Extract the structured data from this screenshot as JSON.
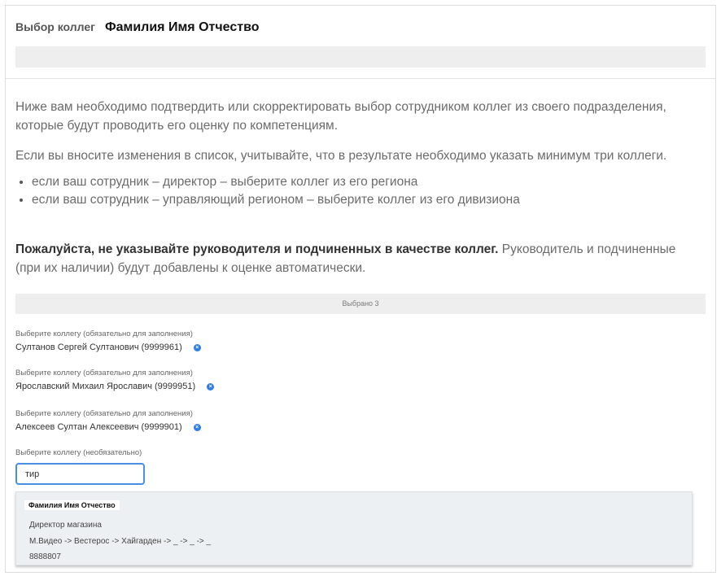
{
  "header": {
    "label": "Выбор коллег",
    "name": "Фамилия Имя Отчество"
  },
  "intro": {
    "p1": "Ниже вам необходимо подтвердить или скорректировать выбор сотрудником коллег из своего подразделения, которые будут проводить его оценку по компетенциям.",
    "p2": "Если вы вносите изменения в список, учитывайте, что в результате необходимо указать минимум три коллеги.",
    "bullets": [
      "если ваш сотрудник – директор – выберите коллег из его региона",
      "если ваш сотрудник – управляющий регионом – выберите коллег из его дивизиона"
    ],
    "p3_bold": "Пожалуйста, не указывайте руководителя и подчиненных в качестве коллег.",
    "p3_rest": " Руководитель и подчиненные (при их наличии) будут добавлены к оценке автоматически."
  },
  "selected_bar": "Выбрано 3",
  "fields": [
    {
      "label": "Выберите коллегу (обязательно для заполнения)",
      "value": "Султанов Сергей Султанович (9999961)"
    },
    {
      "label": "Выберите коллегу (обязательно для заполнения)",
      "value": "Ярославский Михаил Ярославич (9999951)"
    },
    {
      "label": "Выберите коллегу (обязательно для заполнения)",
      "value": "Алексеев Султан Алексеевич (9999901)"
    }
  ],
  "optional_field": {
    "label": "Выберите коллегу (необязательно)",
    "value": "тир"
  },
  "dropdown": {
    "name": "Фамилия Имя Отчество",
    "position": "Директор магазина",
    "path": "М.Видео -> Вестерос -> Хайгарден -> _ -> _ -> _",
    "id": "8888807"
  },
  "icons": {
    "clear": "clear-circle-icon"
  },
  "colors": {
    "accent": "#2f7de1",
    "input_border": "#4a90e2",
    "bar_bg": "#eeeeee",
    "dropdown_bg": "#edf0f2"
  }
}
